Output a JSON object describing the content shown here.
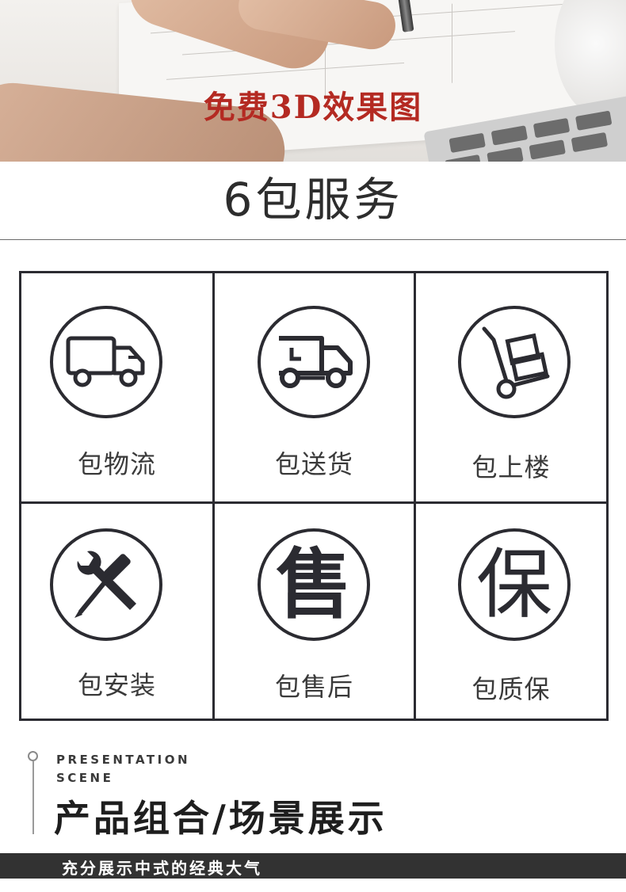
{
  "hero": {
    "title": "免费3D效果图"
  },
  "section": {
    "title": "6包服务"
  },
  "services": [
    {
      "label": "包物流",
      "icon": "truck-icon"
    },
    {
      "label": "包送货",
      "icon": "delivery-truck-icon"
    },
    {
      "label": "包上楼",
      "icon": "hand-trolley-icon"
    },
    {
      "label": "包安装",
      "icon": "tools-icon"
    },
    {
      "label": "包售后",
      "icon": "after-sale-icon",
      "glyph": "售"
    },
    {
      "label": "包质保",
      "icon": "warranty-icon",
      "glyph": "保"
    }
  ],
  "presentation": {
    "en_line1": "PRESENTATION",
    "en_line2": "SCENE",
    "title": "产品组合/场景展示",
    "subtitle": "充分展示中式的经典大气"
  },
  "colors": {
    "ink": "#2b2b31",
    "accent_red": "#b42a22",
    "bar": "#323232"
  }
}
